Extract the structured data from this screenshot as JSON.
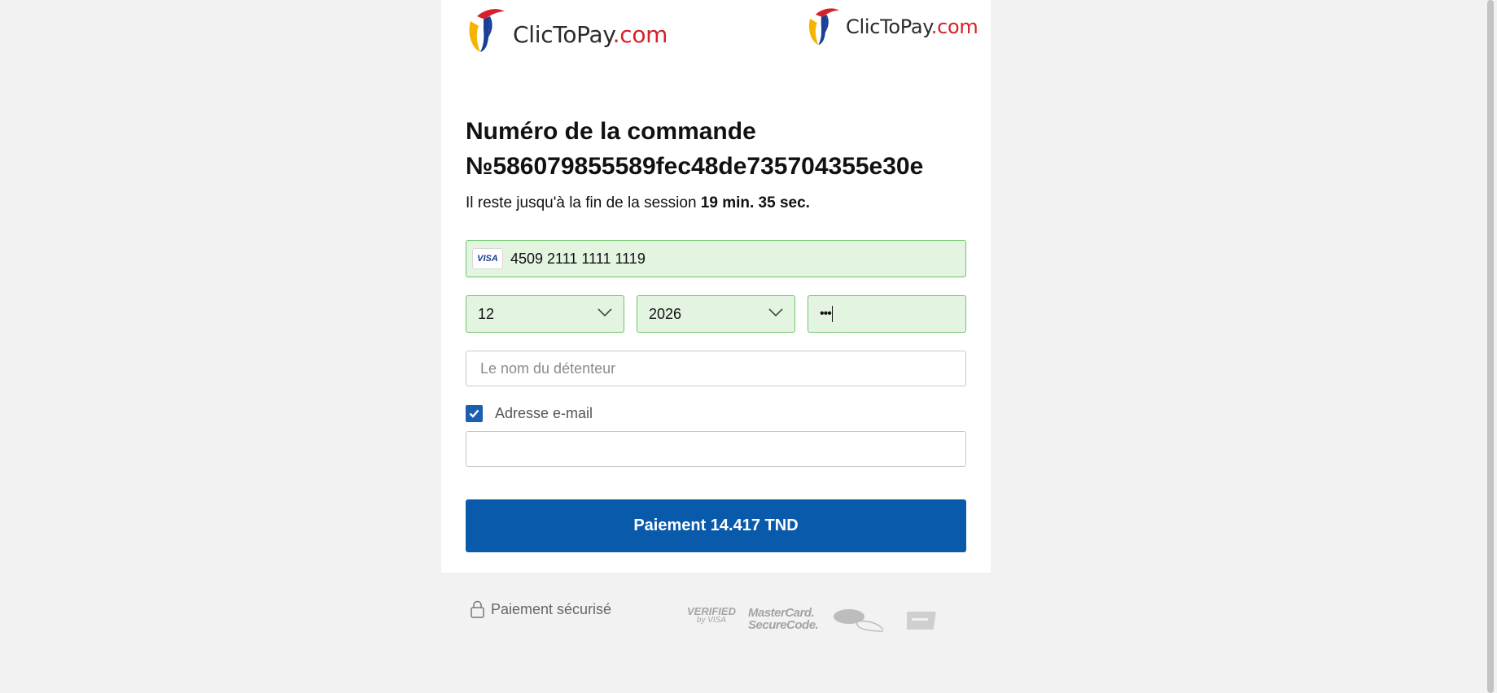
{
  "logo": {
    "brand": "ClicToPay",
    "domain_suffix": ".com"
  },
  "order": {
    "title_line1": "Numéro de la commande",
    "title_line2": "№586079855589fec48de735704355e30e"
  },
  "session": {
    "prefix": "Il reste jusqu'à la fin de la session",
    "remaining": "19 min. 35 sec."
  },
  "form": {
    "card_brand": "VISA",
    "card_number": "4509 2111 1111 1119",
    "expiry_month": "12",
    "expiry_year": "2026",
    "cvv_masked": "•••",
    "holder_placeholder": "Le nom du détenteur",
    "holder_value": "",
    "email_checkbox_checked": true,
    "email_label": "Adresse e-mail",
    "email_value": ""
  },
  "pay_button": {
    "label": "Paiement 14.417 TND"
  },
  "footer": {
    "secure_label": "Paiement sécurisé",
    "verified_line1": "VERIFIED",
    "verified_line2": "by VISA",
    "mastercard_line1": "MasterCard.",
    "mastercard_line2": "SecureCode."
  },
  "colors": {
    "primary": "#0a5aab",
    "valid_field_bg": "#e3f5e1",
    "valid_field_border": "#6cc46a",
    "brand_red": "#d6202a"
  }
}
